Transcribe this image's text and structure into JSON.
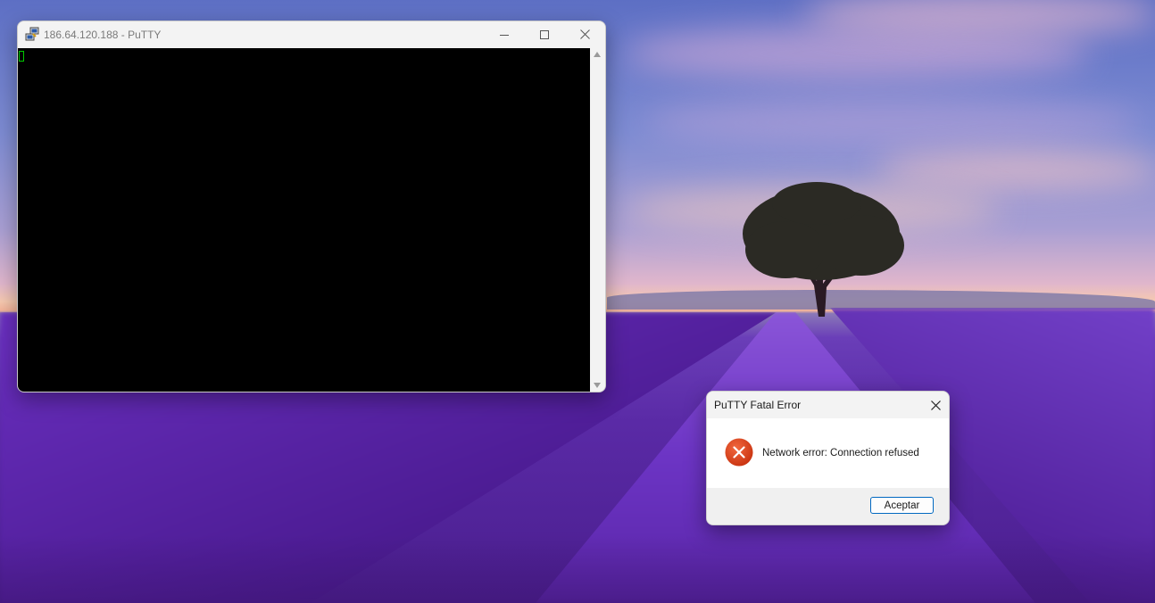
{
  "desktop": {
    "wallpaper": "lavender-field-sunset"
  },
  "putty_window": {
    "title": "186.64.120.188 - PuTTY",
    "icon": "putty-icon",
    "controls": {
      "minimize": "minimize-icon",
      "maximize": "maximize-icon",
      "close": "close-icon"
    },
    "terminal": {
      "background": "#000000",
      "cursor_color": "#00cc00",
      "content": ""
    }
  },
  "error_dialog": {
    "title": "PuTTY Fatal Error",
    "message": "Network error: Connection refused",
    "icon": "error-icon",
    "button_label": "Aceptar",
    "accent_color": "#0067c0",
    "error_color": "#d9441e"
  }
}
